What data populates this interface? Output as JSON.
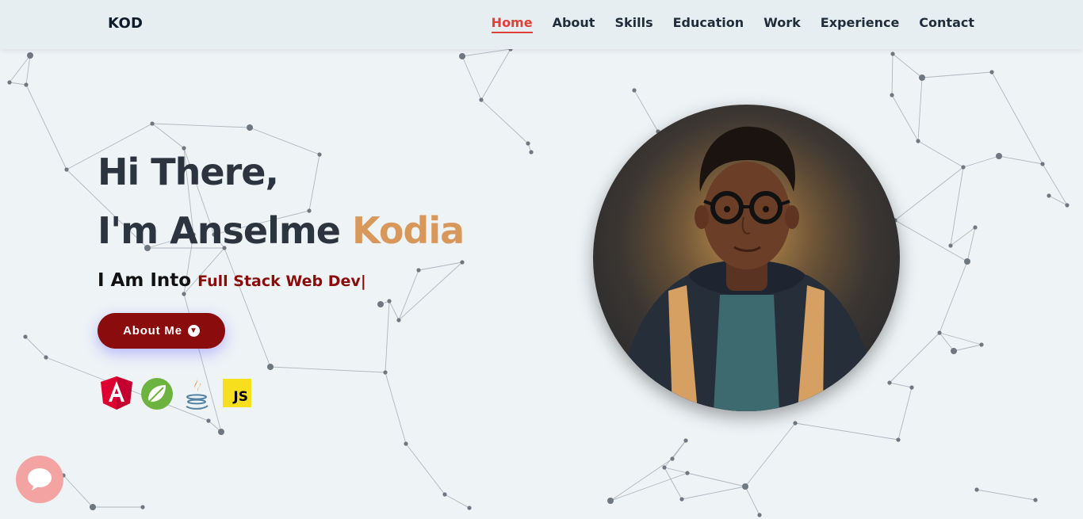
{
  "header": {
    "logo": "KOD",
    "nav": [
      {
        "label": "Home",
        "active": true
      },
      {
        "label": "About"
      },
      {
        "label": "Skills"
      },
      {
        "label": "Education"
      },
      {
        "label": "Work"
      },
      {
        "label": "Experience"
      },
      {
        "label": "Contact"
      }
    ]
  },
  "hero": {
    "greeting": "Hi There,",
    "intro_prefix": "I'm Anselme ",
    "intro_accent": "Kodia",
    "into_label": "I Am Into",
    "typed_text": "Full Stack Web Dev|",
    "button_label": "About Me",
    "accent_color": "#d9985b",
    "button_color": "#8a0c0c"
  },
  "tech_icons": [
    "angular-icon",
    "spring-icon",
    "java-icon",
    "javascript-icon"
  ],
  "js_badge": "JS",
  "chat_widget": {
    "icon": "chat-bubble-icon"
  }
}
